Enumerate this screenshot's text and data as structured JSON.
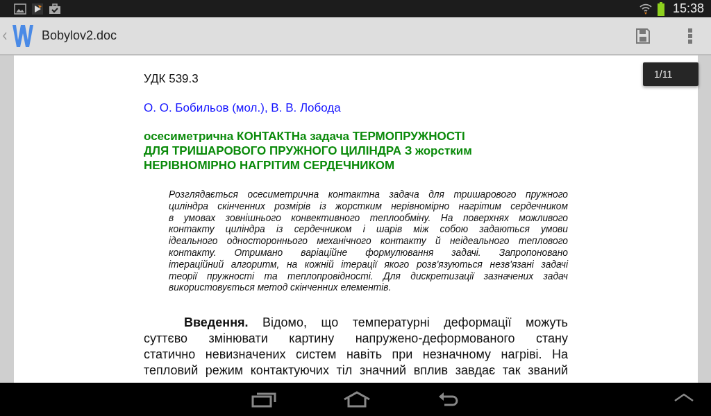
{
  "status_bar": {
    "time": "15:38"
  },
  "app_bar": {
    "title": "Bobylov2.doc"
  },
  "page_indicator": "1/11",
  "document": {
    "udc": "УДК 539.3",
    "authors": "О. О. Бобильов (мол.), В. В. Лобода",
    "title_lines": [
      "осесиметрична КОНТАКТНа задача ТЕРМОПРУЖНОСТІ",
      "ДЛЯ ТРИШАРОВОГО ПРУЖНОГО ЦИЛІНДРА З жорстким",
      "НЕРІВНОМІРНО НАГРІТИМ СЕРДЕЧНИКОМ"
    ],
    "abstract_lines": [
      "Розглядається осесиметрична контактна задача для тришарового пружного",
      "циліндра скінченних розмірів із жорстким нерівномірно нагрітим сердечником",
      "в умовах зовнішнього конвективного теплообміну. На поверхнях можливого",
      "контакту циліндра із сердечником і шарів між собою задаються умови",
      "ідеального одностороннього механічного контакту й неідеального теплового",
      "контакту. Отримано варіаційне формулювання задачі. Запропоновано",
      "ітераційний алгоритм, на кожній ітерації якого розв'язуються незв'язані задачі",
      "теорії пружності та теплопровідності. Для дискретизації зазначених задач",
      "використовується метод скінченних елементів."
    ],
    "intro_lines": [
      "**Введення.** Відомо, що температурні деформації можуть",
      "суттєво змінювати картину напружено-деформованого стану",
      "статично невизначених систем навіть при незначному нагріві. На",
      "тепловий режим контактуючих тіл значний вплив завдає так званий"
    ]
  }
}
